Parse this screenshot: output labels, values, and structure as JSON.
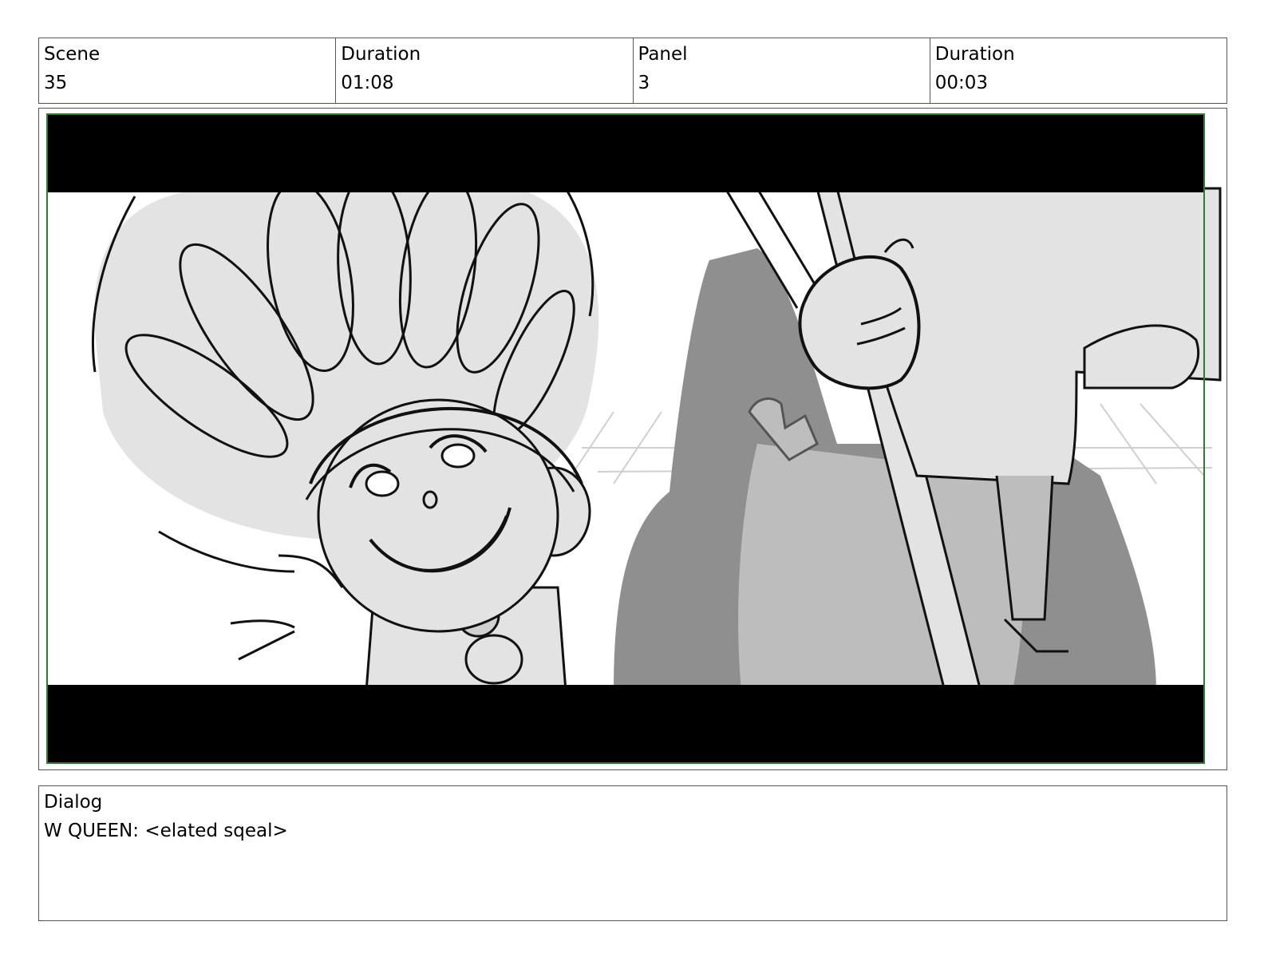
{
  "header": {
    "scene_label": "Scene",
    "scene_value": "35",
    "scene_duration_label": "Duration",
    "scene_duration_value": "01:08",
    "panel_label": "Panel",
    "panel_value": "3",
    "panel_duration_label": "Duration",
    "panel_duration_value": "00:03"
  },
  "dialog": {
    "label": "Dialog",
    "text": "W QUEEN: <elated sqeal>"
  },
  "colors": {
    "frame_border": "#2e7d32",
    "sketch_light": "#e3e3e3",
    "sketch_mid": "#bdbdbd",
    "sketch_dark": "#8f8f8f",
    "letterbox": "#000000"
  }
}
